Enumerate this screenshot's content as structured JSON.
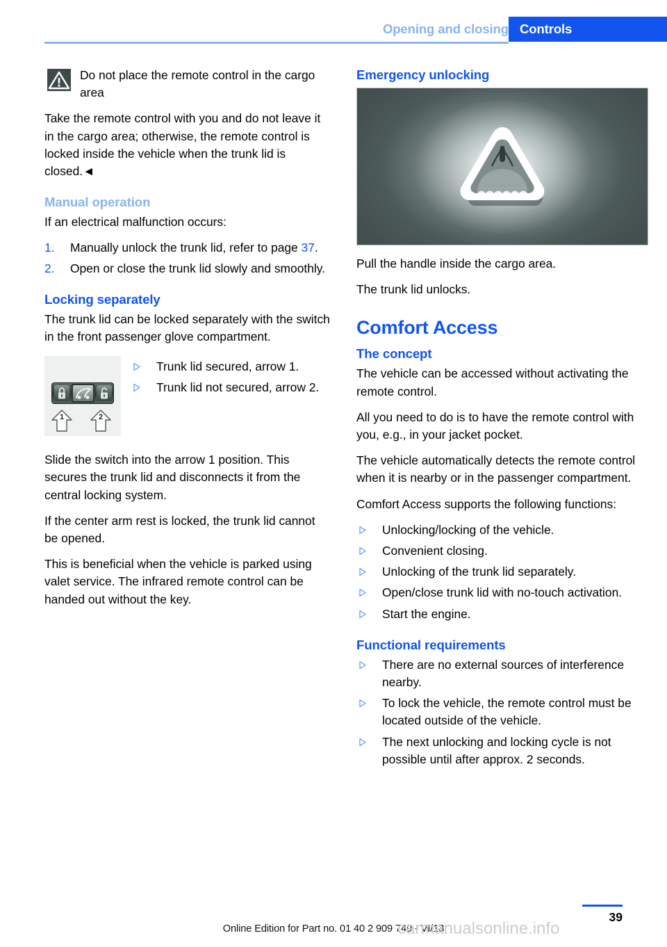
{
  "header": {
    "chapter": "Opening and closing",
    "section_tab": "Controls",
    "accent_blue": "#1155ee",
    "light_blue": "#8ab4f0"
  },
  "left_column": {
    "warning": {
      "icon": "warning-triangle-icon",
      "title": "Do not place the remote control in the cargo area",
      "body": "Take the remote control with you and do not leave it in the cargo area; otherwise, the remote control is locked inside the vehicle when the trunk lid is closed.◄"
    },
    "manual_operation": {
      "heading": "Manual operation",
      "intro": "If an electrical malfunction occurs:",
      "steps": [
        {
          "num": "1.",
          "text_before": "Manually unlock the trunk lid, refer to page ",
          "page_ref": "37",
          "text_after": "."
        },
        {
          "num": "2.",
          "text_before": "Open or close the trunk lid slowly and smoothly.",
          "page_ref": "",
          "text_after": ""
        }
      ]
    },
    "locking_separately": {
      "heading": "Locking separately",
      "intro": "The trunk lid can be locked separately with the switch in the front passenger glove compartment.",
      "figure_caption_bullets": [
        "Trunk lid secured, arrow 1.",
        "Trunk lid not secured, arrow 2."
      ],
      "figure_name": "trunk-lock-switch-figure",
      "figure_labels": [
        "1",
        "2"
      ],
      "paragraphs": [
        "Slide the switch into the arrow 1 position. This secures the trunk lid and disconnects it from the central locking system.",
        "If the center arm rest is locked, the trunk lid cannot be opened.",
        "This is beneficial when the vehicle is parked using valet service. The infrared remote control can be handed out without the key."
      ]
    }
  },
  "right_column": {
    "emergency_unlocking": {
      "heading": "Emergency unlocking",
      "figure_name": "emergency-release-handle-photo",
      "paragraphs": [
        "Pull the handle inside the cargo area.",
        "The trunk lid unlocks."
      ]
    },
    "comfort_access": {
      "heading": "Comfort Access",
      "the_concept": {
        "heading": "The concept",
        "paragraphs": [
          "The vehicle can be accessed without activating the remote control.",
          "All you need to do is to have the remote control with you, e.g., in your jacket pocket.",
          "The vehicle automatically detects the remote control when it is nearby or in the passenger compartment.",
          "Comfort Access supports the following functions:"
        ],
        "bullets": [
          "Unlocking/locking of the vehicle.",
          "Convenient closing.",
          "Unlocking of the trunk lid separately.",
          "Open/close trunk lid with no-touch activation.",
          "Start the engine."
        ]
      },
      "functional_requirements": {
        "heading": "Functional requirements",
        "bullets": [
          "There are no external sources of interference nearby.",
          "To lock the vehicle, the remote control must be located outside of the vehicle.",
          "The next unlocking and locking cycle is not possible until after approx. 2 seconds."
        ]
      }
    }
  },
  "footer": {
    "page_number": "39",
    "edition": "Online Edition for Part no. 01 40 2 909 749 - VI/13",
    "watermark": "carmanualsonline.info"
  }
}
